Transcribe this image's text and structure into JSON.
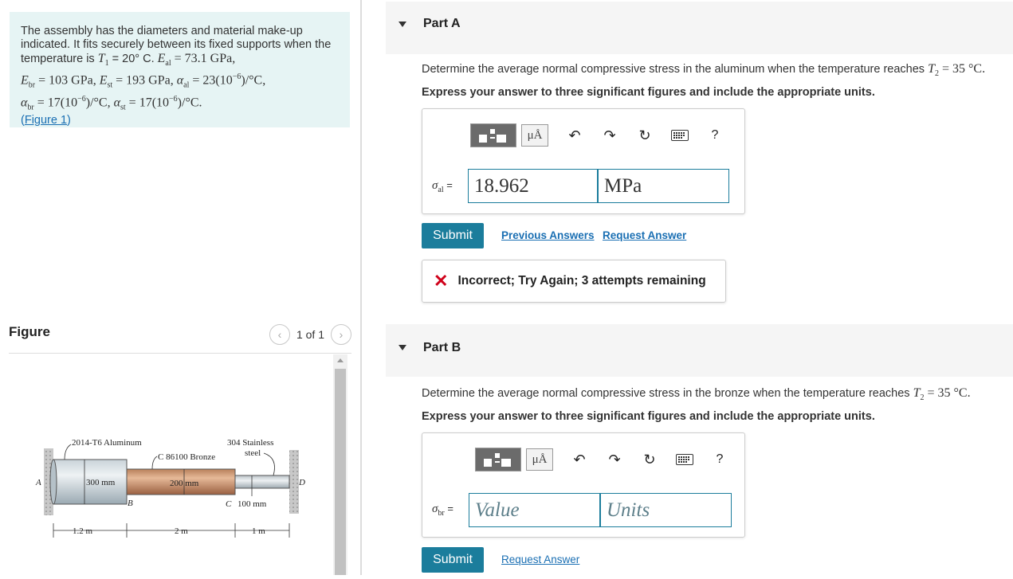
{
  "problem": {
    "line1": "The assembly has the diameters and material make-up",
    "line2": "indicated. It fits securely between its fixed supports when the",
    "line3_prefix": "temperature is ",
    "T1": "T",
    "T1_sub": "1",
    "T1_val": " = 20° C. ",
    "Eal": "E",
    "Eal_sub": "al",
    "Eal_val": " = 73.1 GPa,",
    "line4": "E",
    "Ebr_sub": "br",
    "Ebr_val": " = 103 GPa, ",
    "Est": "E",
    "Est_sub": "st",
    "Est_val": " = 193 GPa, ",
    "alpha_al": "α",
    "alpha_al_sub": "al",
    "alpha_al_val": " = 23(10",
    "alpha_al_exp": "−6",
    "alpha_al_unit": ")/°C,",
    "alpha_br": "α",
    "alpha_br_sub": "br",
    "alpha_br_val": " = 17(10",
    "alpha_br_exp": "−6",
    "alpha_br_unit": ")/°C, ",
    "alpha_st": "α",
    "alpha_st_sub": "st",
    "alpha_st_val": " = 17(10",
    "alpha_st_exp": "−6",
    "alpha_st_unit": ")/°C.",
    "figure_link_open": "(",
    "figure_link": "Figure 1",
    "figure_link_close": ")"
  },
  "figure": {
    "title": "Figure",
    "pager": "1 of 1",
    "labels": {
      "aluminum": "2014-T6 Aluminum",
      "bronze": "C 86100 Bronze",
      "steel_1": "304 Stainless",
      "steel_2": "steel",
      "A": "A",
      "B": "B",
      "C": "C",
      "D": "D",
      "d_al": "300 mm",
      "d_br": "200 mm",
      "d_st": "100 mm",
      "len_al": "1.2 m",
      "len_br": "2 m",
      "len_st": "1 m"
    }
  },
  "partA": {
    "title": "Part A",
    "question_prefix": "Determine the average normal compressive stress in the aluminum when the temperature reaches ",
    "T2": "T",
    "T2_sub": "2",
    "T2_val": " = 35 °C.",
    "instruction": "Express your answer to three significant figures and include the appropriate units.",
    "var": "σ",
    "var_sub": "al",
    "var_eq": " =",
    "value": "18.962",
    "units": "MPa",
    "submit": "Submit",
    "previous_answers": "Previous Answers",
    "request_answer": "Request Answer",
    "feedback_icon": "✕",
    "feedback": "Incorrect; Try Again; 3 attempts remaining"
  },
  "partB": {
    "title": "Part B",
    "question_prefix": "Determine the average normal compressive stress in the bronze when the temperature reaches ",
    "T2": "T",
    "T2_sub": "2",
    "T2_val": " = 35 °C.",
    "instruction": "Express your answer to three significant figures and include the appropriate units.",
    "var": "σ",
    "var_sub": "br",
    "var_eq": " =",
    "value_placeholder": "Value",
    "units_placeholder": "Units",
    "submit": "Submit",
    "request_answer": "Request Answer"
  },
  "toolbar": {
    "mu_label": "μÅ",
    "help": "?",
    "icons": [
      "templates-icon",
      "units-icon",
      "undo-icon",
      "redo-icon",
      "reset-icon",
      "keyboard-icon",
      "help-icon"
    ]
  },
  "colors": {
    "accent": "#1b7d9c",
    "problem_bg": "#e6f4f4",
    "error": "#d0021b",
    "link": "#1a6fb3"
  }
}
